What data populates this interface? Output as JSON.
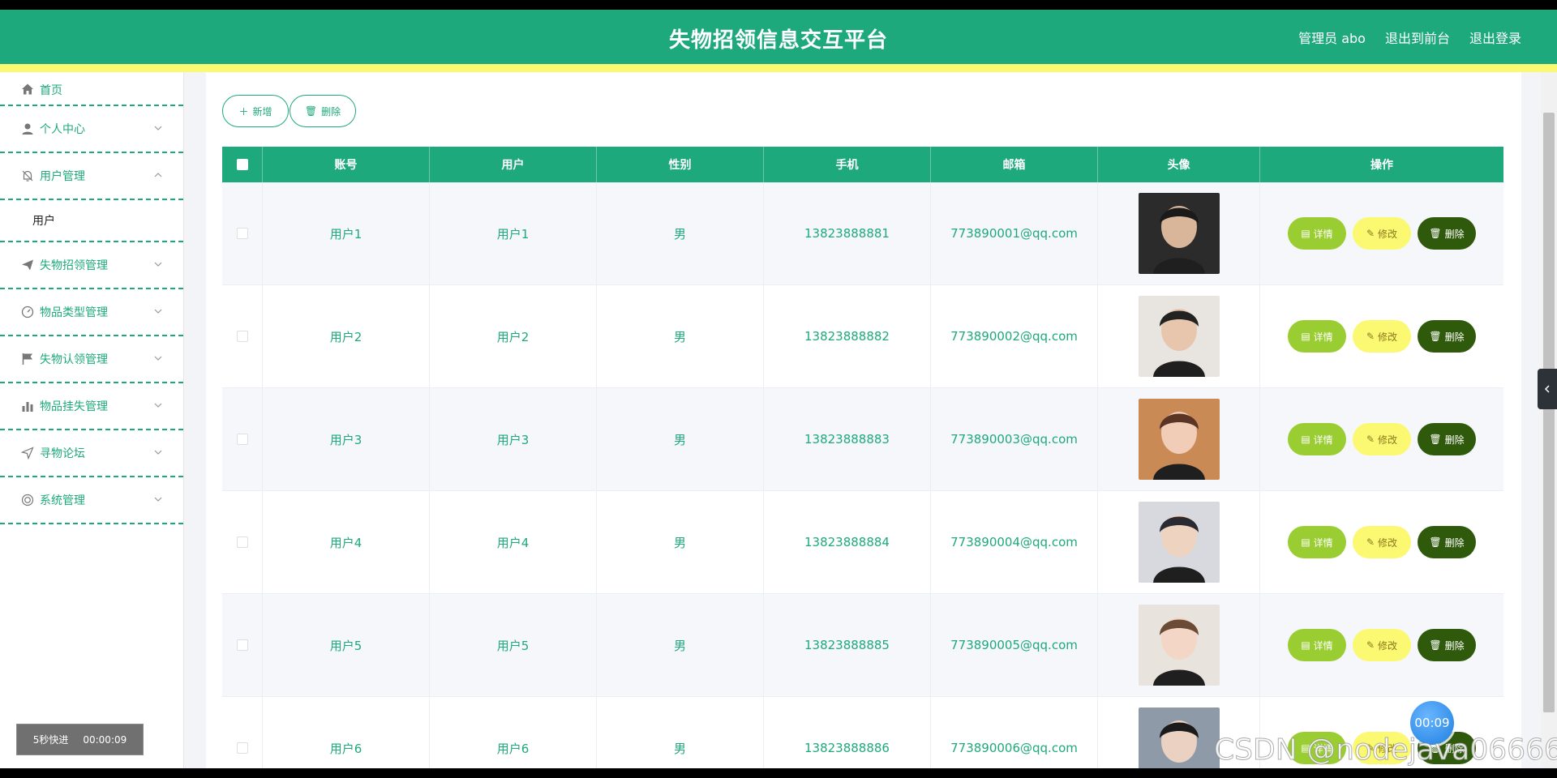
{
  "header": {
    "title": "失物招领信息交互平台",
    "admin": "管理员 abo",
    "exit_front": "退出到前台",
    "logout": "退出登录"
  },
  "sidebar": {
    "items": [
      {
        "label": "首页",
        "icon": "home-icon"
      },
      {
        "label": "个人中心",
        "icon": "user-icon"
      },
      {
        "label": "用户管理",
        "icon": "bell-off-icon",
        "expanded": true
      },
      {
        "label": "失物招领管理",
        "icon": "send-icon"
      },
      {
        "label": "物品类型管理",
        "icon": "gauge-icon"
      },
      {
        "label": "失物认领管理",
        "icon": "flag-icon"
      },
      {
        "label": "物品挂失管理",
        "icon": "bar-chart-icon"
      },
      {
        "label": "寻物论坛",
        "icon": "navigation-icon"
      },
      {
        "label": "系统管理",
        "icon": "settings-icon"
      }
    ],
    "sub_user": "用户"
  },
  "toolbar": {
    "add_label": "新增",
    "delete_label": "删除"
  },
  "table": {
    "headers": [
      "账号",
      "用户",
      "性别",
      "手机",
      "邮箱",
      "头像",
      "操作"
    ],
    "rows": [
      {
        "account": "用户1",
        "user": "用户1",
        "gender": "男",
        "phone": "13823888881",
        "email": "773890001@qq.com"
      },
      {
        "account": "用户2",
        "user": "用户2",
        "gender": "男",
        "phone": "13823888882",
        "email": "773890002@qq.com"
      },
      {
        "account": "用户3",
        "user": "用户3",
        "gender": "男",
        "phone": "13823888883",
        "email": "773890003@qq.com"
      },
      {
        "account": "用户4",
        "user": "用户4",
        "gender": "男",
        "phone": "13823888884",
        "email": "773890004@qq.com"
      },
      {
        "account": "用户5",
        "user": "用户5",
        "gender": "男",
        "phone": "13823888885",
        "email": "773890005@qq.com"
      },
      {
        "account": "用户6",
        "user": "用户6",
        "gender": "男",
        "phone": "13823888886",
        "email": "773890006@qq.com"
      }
    ],
    "actions": {
      "detail": "详情",
      "edit": "修改",
      "delete": "删除"
    }
  },
  "overlay": {
    "player_speed": "5秒快进",
    "player_time": "00:00:09",
    "timer": "00:09",
    "watermark": "CSDN @nodejava066666"
  },
  "colors": {
    "primary": "#1ea97c",
    "accent_yellow": "#fbf872",
    "detail_green": "#9acd32",
    "delete_dark": "#2f5a0b"
  }
}
